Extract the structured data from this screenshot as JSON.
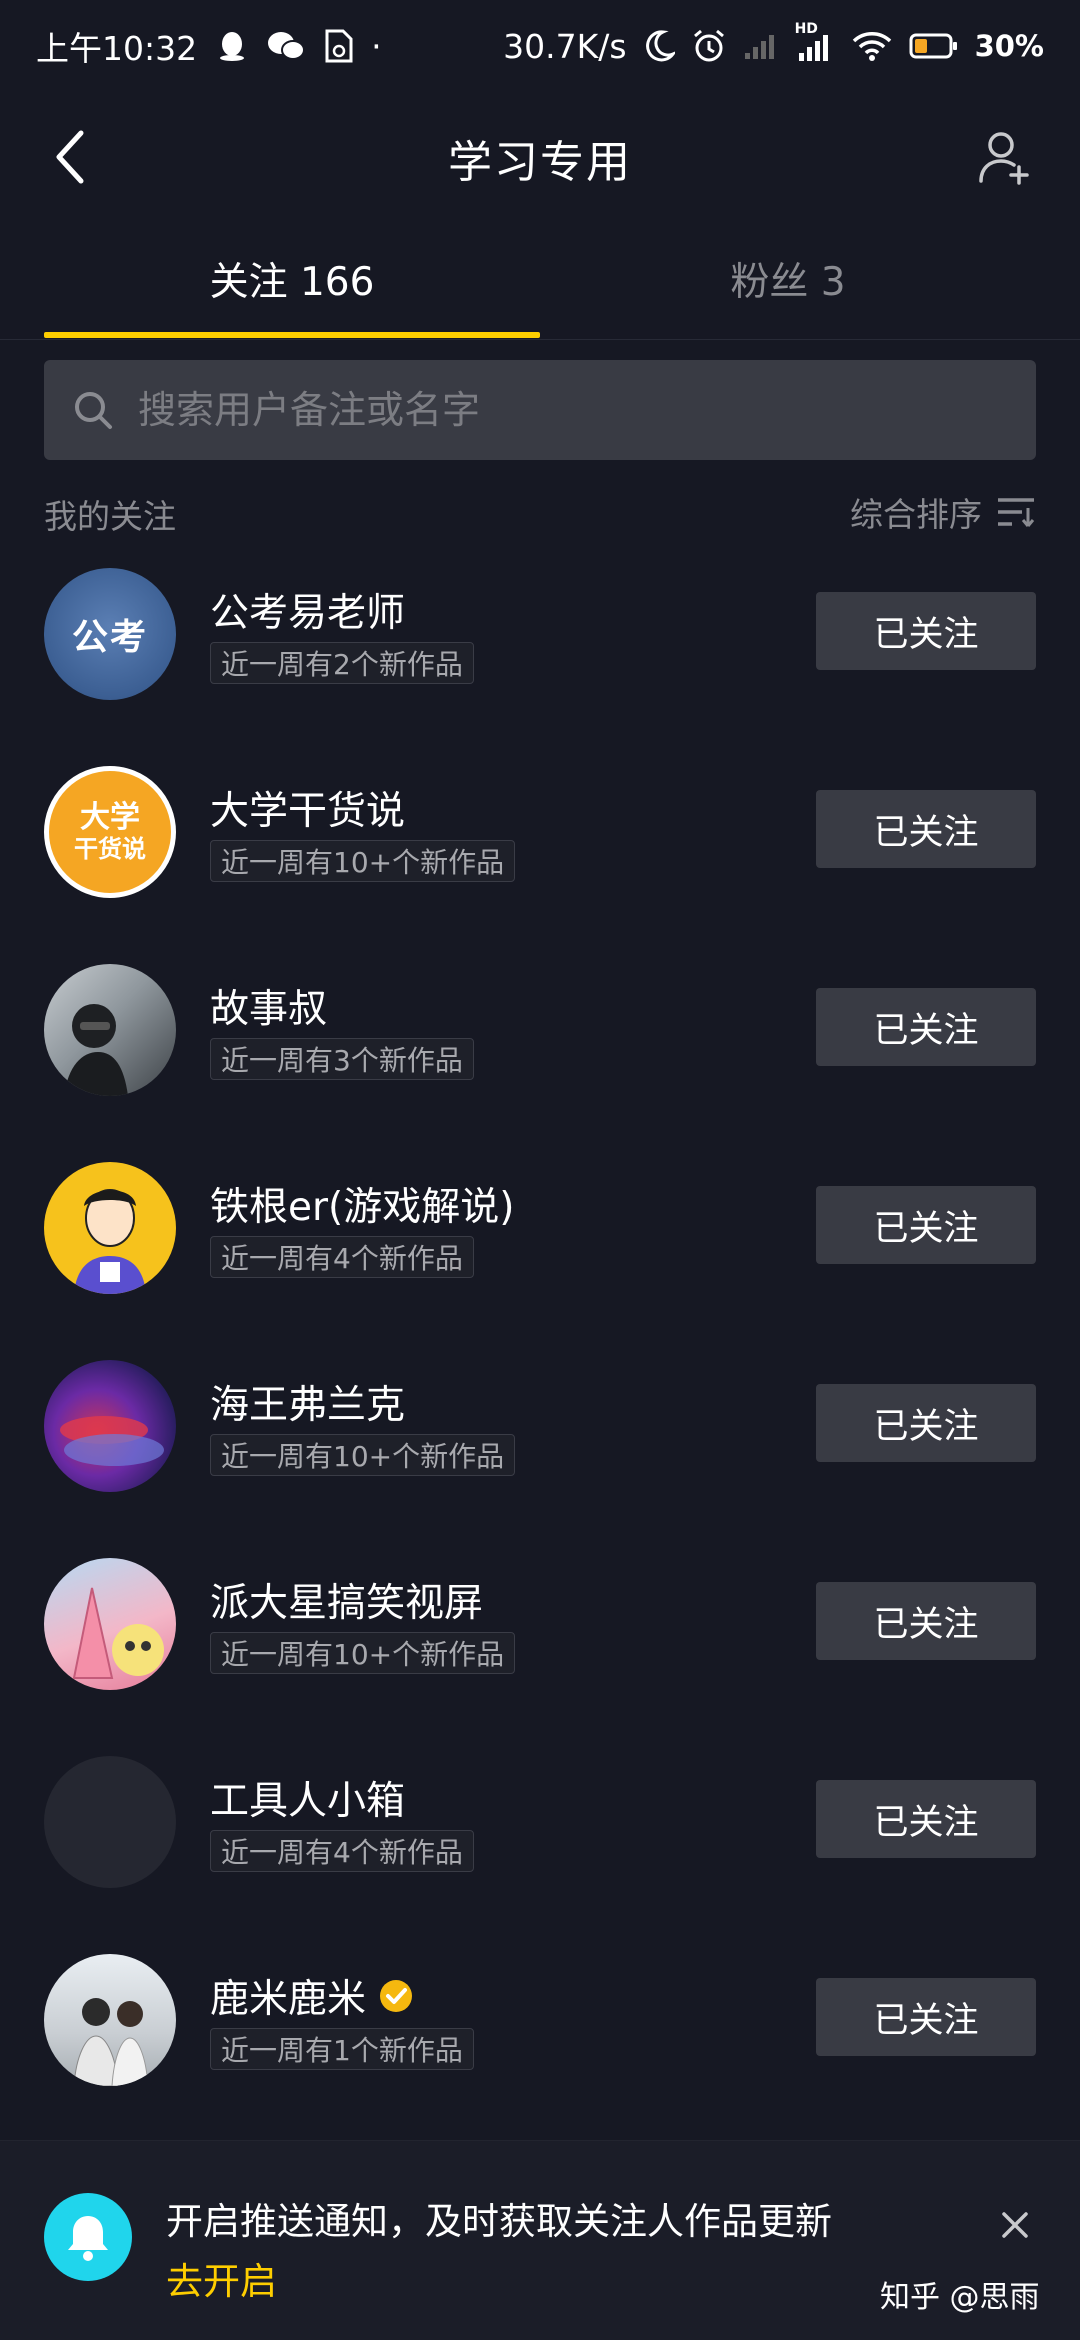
{
  "status_bar": {
    "time": "上午10:32",
    "dot": "·",
    "speed": "30.7K/s",
    "hd": "HD",
    "battery": "30%",
    "icons": [
      "qq-icon",
      "wechat-icon",
      "sim-icon",
      "moon-icon",
      "alarm-icon",
      "signal-icon",
      "signal-hd-icon",
      "wifi-icon",
      "battery-icon"
    ]
  },
  "header": {
    "title": "学习专用",
    "back_icon": "chevron-left-icon",
    "add_icon": "add-user-icon"
  },
  "tabs": [
    {
      "label": "关注 166",
      "active": true
    },
    {
      "label": "粉丝 3",
      "active": false
    }
  ],
  "search": {
    "placeholder": "搜索用户备注或名字",
    "value": ""
  },
  "section": {
    "title": "我的关注",
    "sort_label": "综合排序"
  },
  "following": [
    {
      "name": "公考易老师",
      "badge": "近一周有2个新作品",
      "button": "已关注",
      "avatar_text": "公考",
      "verified": false
    },
    {
      "name": "大学干货说",
      "badge": "近一周有10+个新作品",
      "button": "已关注",
      "avatar_text": "大学",
      "avatar_text2": "干货说",
      "verified": false
    },
    {
      "name": "故事叔",
      "badge": "近一周有3个新作品",
      "button": "已关注",
      "verified": false
    },
    {
      "name": "铁根er(游戏解说)",
      "badge": "近一周有4个新作品",
      "button": "已关注",
      "verified": false
    },
    {
      "name": "海王弗兰克",
      "badge": "近一周有10+个新作品",
      "button": "已关注",
      "verified": false
    },
    {
      "name": "派大星搞笑视屏",
      "badge": "近一周有10+个新作品",
      "button": "已关注",
      "verified": false
    },
    {
      "name": "工具人小箱",
      "badge": "近一周有4个新作品",
      "button": "已关注",
      "verified": false
    },
    {
      "name": "鹿米鹿米",
      "badge": "近一周有1个新作品",
      "button": "已关注",
      "verified": true
    }
  ],
  "notification": {
    "text": "开启推送通知，及时获取关注人作品更新",
    "link": "去开启"
  },
  "watermark": "知乎 @思雨",
  "colors": {
    "background": "#161823",
    "accent": "#fece00",
    "button_bg": "#393b44",
    "bell": "#20d5ec",
    "verified": "#f5b80f"
  }
}
